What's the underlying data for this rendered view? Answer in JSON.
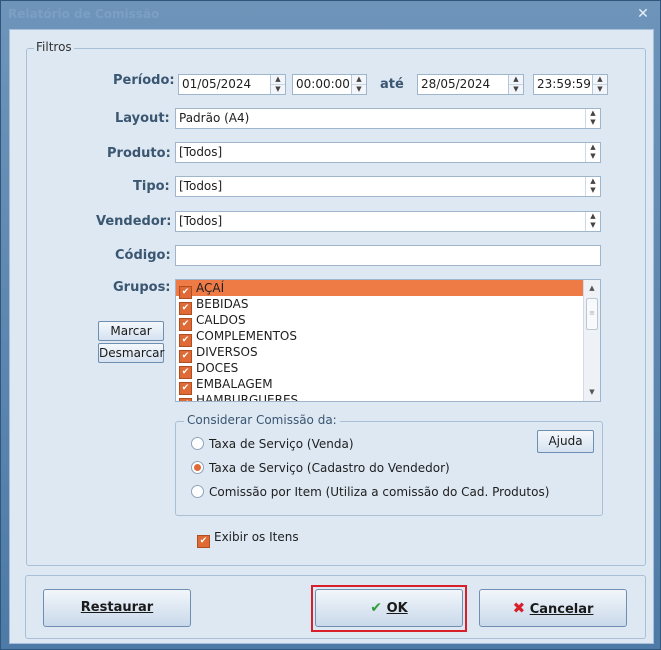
{
  "window": {
    "title": "Relatório de Comissão",
    "close_glyph": "✕"
  },
  "filters": {
    "group_title": "Filtros",
    "periodo": {
      "label": "Período:",
      "start_date": "01/05/2024",
      "start_time": "00:00:00",
      "sep_label": "até",
      "end_date": "28/05/2024",
      "end_time": "23:59:59"
    },
    "layout": {
      "label": "Layout:",
      "value": "Padrão (A4)"
    },
    "produto": {
      "label": "Produto:",
      "value": "[Todos]"
    },
    "tipo": {
      "label": "Tipo:",
      "value": "[Todos]"
    },
    "vendedor": {
      "label": "Vendedor:",
      "value": "[Todos]"
    },
    "codigo": {
      "label": "Código:",
      "value": ""
    },
    "grupos": {
      "label": "Grupos:",
      "items": [
        "AÇAÍ",
        "BEBIDAS",
        "CALDOS",
        "COMPLEMENTOS",
        "DIVERSOS",
        "DOCES",
        "EMBALAGEM",
        "HAMBURGUERES"
      ],
      "selected_index": 0,
      "all_checked": true,
      "marcar_label": "Marcar",
      "desmarcar_label": "Desmarcar"
    },
    "comissao": {
      "title": "Considerar Comissão da:",
      "options": [
        "Taxa de Serviço (Venda)",
        "Taxa de Serviço (Cadastro do Vendedor)",
        "Comissão por Item (Utiliza a comissão do Cad. Produtos)"
      ],
      "selected_index": 1,
      "help_label": "Ajuda"
    },
    "exibir_itens": {
      "label": "Exibir os Itens",
      "checked": true
    }
  },
  "buttons": {
    "restaurar_label": "Restaurar",
    "ok_label": "OK",
    "cancelar_label": "Cancelar"
  },
  "colors": {
    "accent": "#e06a35",
    "highlight_frame": "#d8202a",
    "ok_icon": "#2e9e3a",
    "cancel_icon": "#d8202a"
  },
  "icons": {
    "ok": "check-icon",
    "cancel": "x-icon"
  }
}
